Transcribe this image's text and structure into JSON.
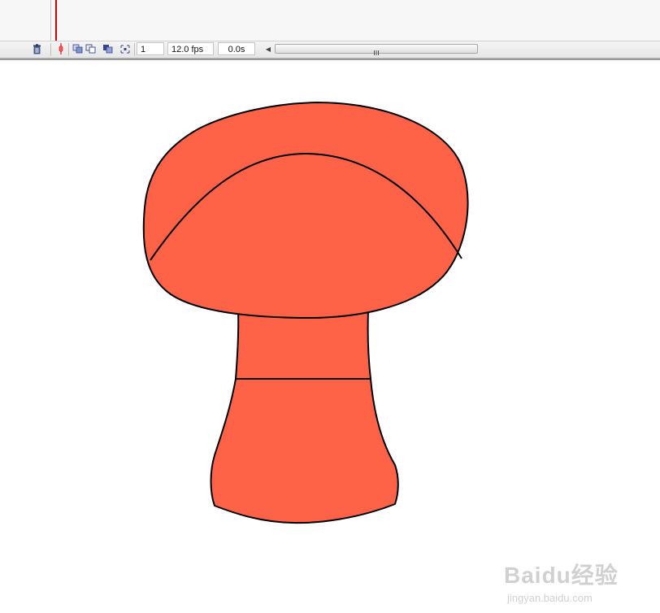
{
  "timeline": {
    "frame_number": "1",
    "frame_rate": "12.0 fps",
    "elapsed_time": "0.0s"
  },
  "icons": {
    "trash": "trash-icon",
    "center_frame": "center-frame-icon",
    "onion_skin": "onion-skin-icon",
    "onion_skin_outlines": "onion-skin-outlines-icon",
    "edit_multiple_frames": "edit-multiple-frames-icon",
    "modify_markers": "modify-onion-markers-icon",
    "scroll_left": "scroll-left-arrow-icon",
    "scroll_grip": "scroll-grip-icon"
  },
  "stage": {
    "fill_color": "#ff6347",
    "stroke_color": "#000000",
    "background": "#ffffff"
  },
  "watermark": {
    "brand": "Baidu经验",
    "url": "jingyan.baidu.com"
  }
}
